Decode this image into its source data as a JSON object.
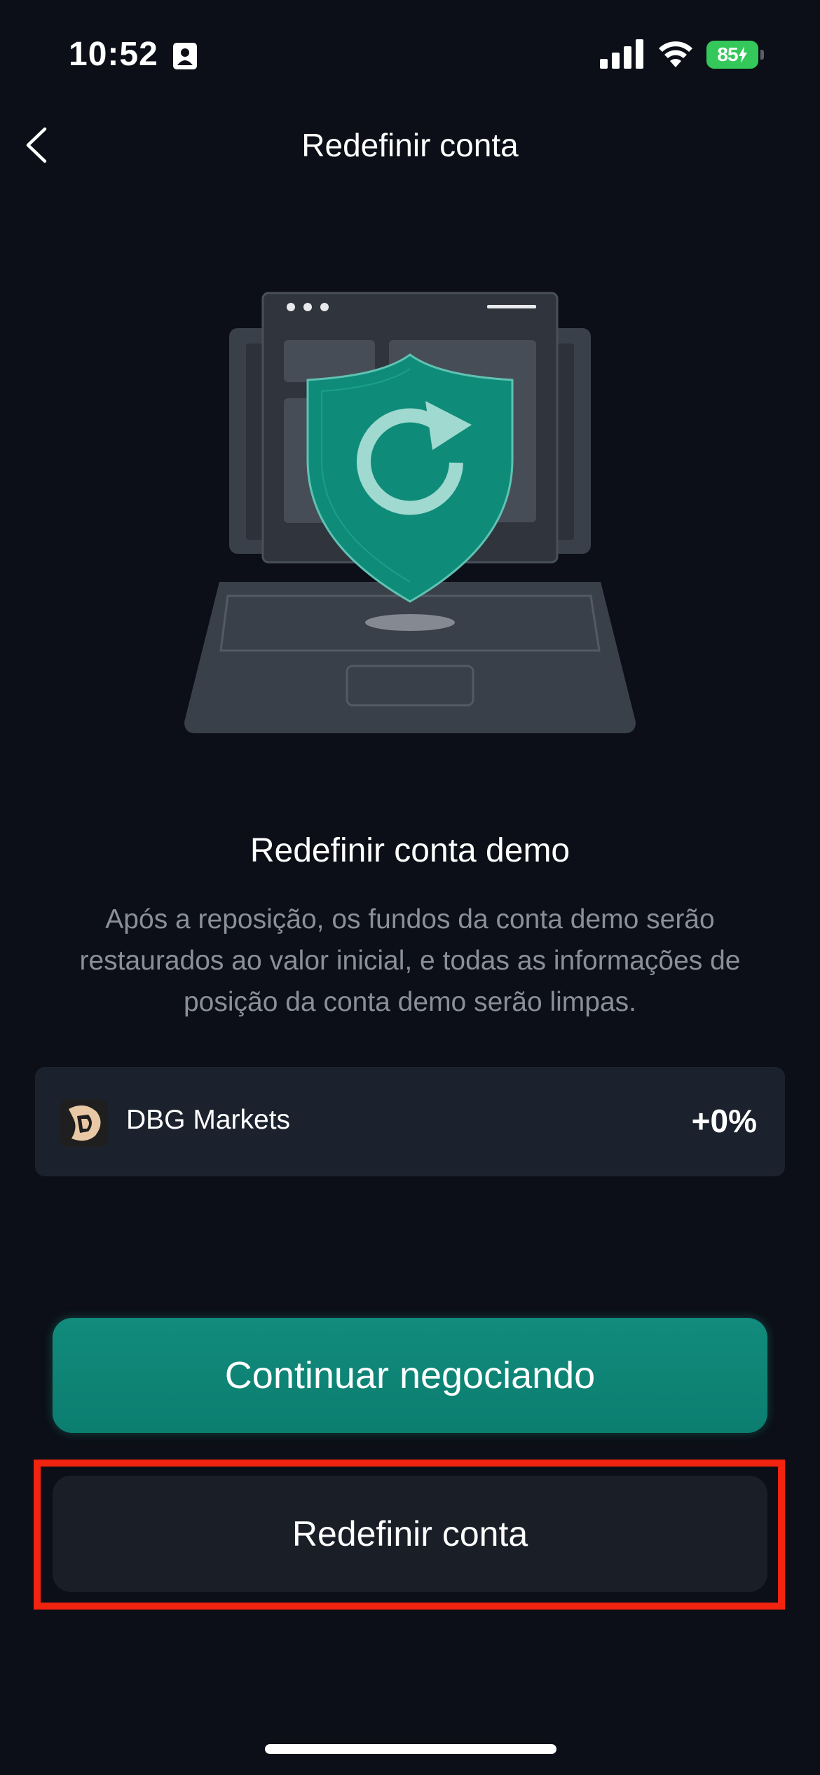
{
  "status_bar": {
    "time": "10:52",
    "battery": "85"
  },
  "nav": {
    "title": "Redefinir conta"
  },
  "content": {
    "heading": "Redefinir conta demo",
    "description": "Após a reposição, os fundos da conta demo serão restaurados ao valor inicial, e todas as informações de posição da conta demo serão limpas."
  },
  "account": {
    "name": "DBG Markets",
    "value": "+0%"
  },
  "buttons": {
    "continue_label": "Continuar negociando",
    "reset_label": "Redefinir conta"
  },
  "colors": {
    "background": "#0c0f17",
    "accent": "#0b7e70",
    "highlight": "#f2230f",
    "battery": "#34c759"
  }
}
